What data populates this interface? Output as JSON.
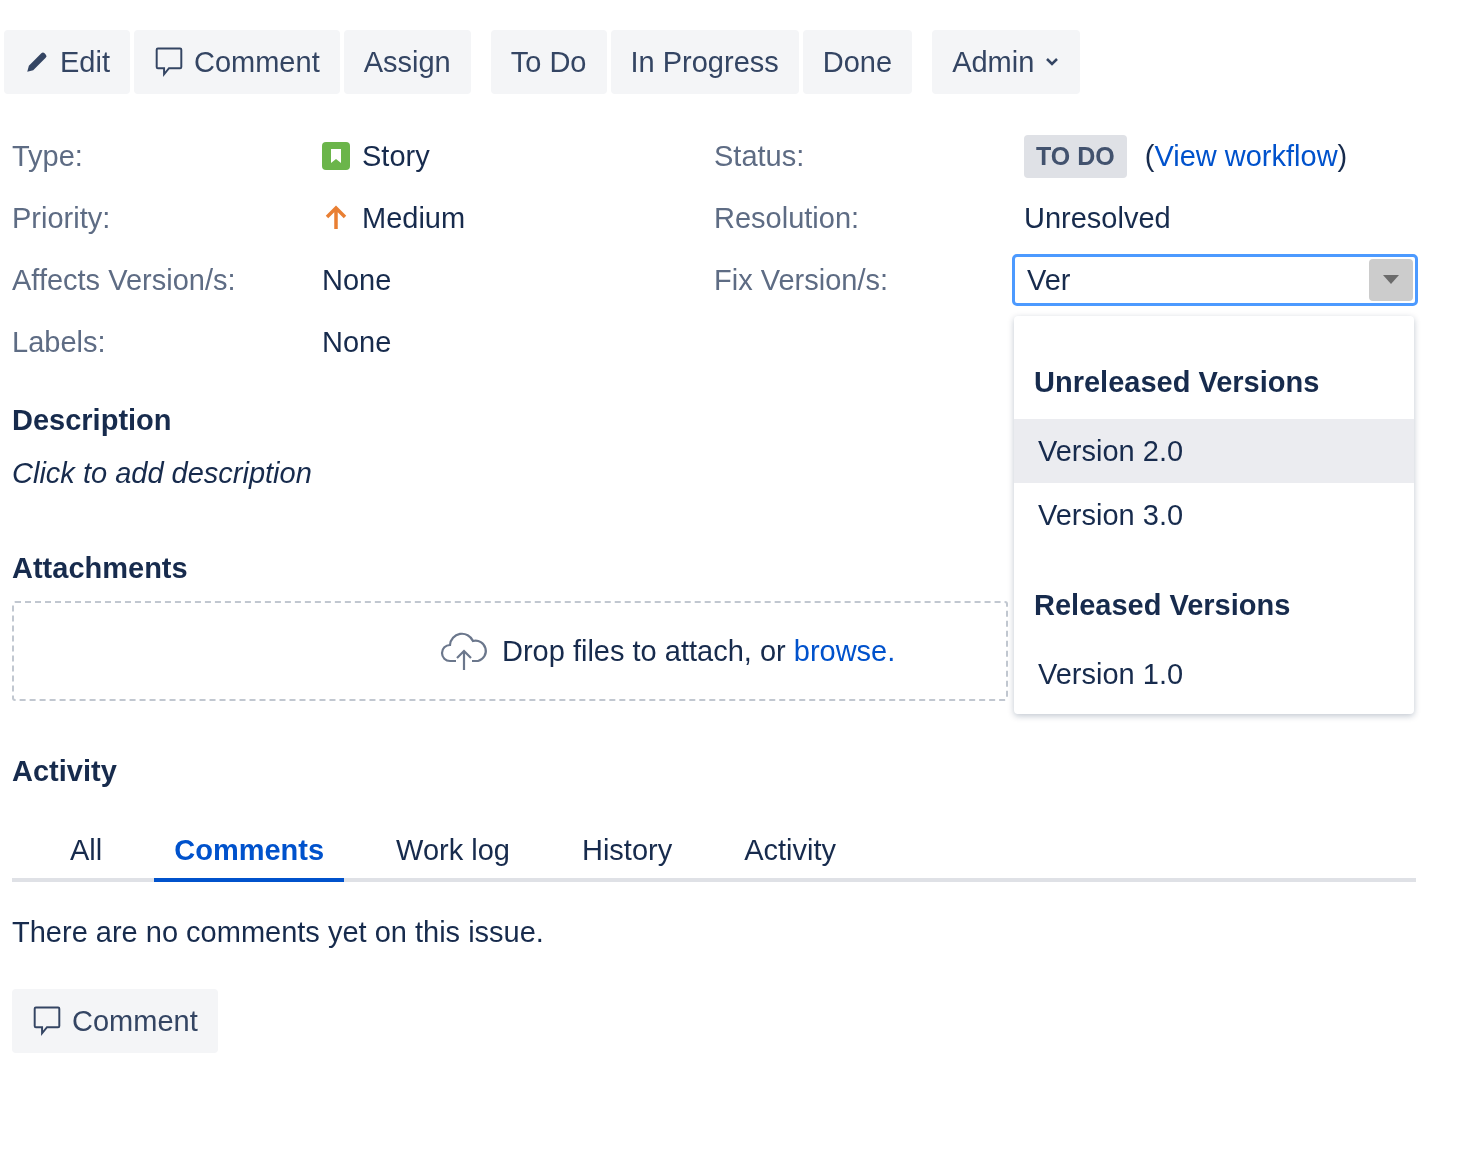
{
  "toolbar": [
    {
      "buttons": [
        {
          "label": "Edit",
          "kind": "edit"
        },
        {
          "label": "Comment",
          "kind": "comment"
        },
        {
          "label": "Assign",
          "kind": "plain"
        }
      ]
    },
    {
      "buttons": [
        {
          "label": "To Do",
          "kind": "plain"
        },
        {
          "label": "In Progress",
          "kind": "plain"
        },
        {
          "label": "Done",
          "kind": "plain"
        }
      ]
    },
    {
      "buttons": [
        {
          "label": "Admin",
          "kind": "menu"
        }
      ]
    }
  ],
  "fields": [
    {
      "label": "Type:",
      "kind": "issue_type",
      "value": "Story"
    },
    {
      "label": "Status:",
      "kind": "lozenge",
      "value": "TO DO",
      "before": "(",
      "link": "View workflow",
      "after": ")"
    },
    {
      "label": "Priority:",
      "kind": "priority",
      "value": "Medium"
    },
    {
      "label": "Resolution:",
      "kind": "text",
      "value": "Unresolved"
    },
    {
      "label": "Affects Version/s:",
      "kind": "text",
      "value": "None"
    },
    {
      "label": "Fix Version/s:",
      "kind": "select",
      "value": "Ver"
    },
    {
      "label": "Labels:",
      "kind": "text",
      "value": "None"
    }
  ],
  "version_menu": [
    {
      "heading": "Unreleased Versions",
      "items": [
        {
          "label": "Version 2.0",
          "selected": true
        },
        {
          "label": "Version 3.0",
          "selected": false
        }
      ]
    },
    {
      "heading": "Released Versions",
      "items": [
        {
          "label": "Version 1.0",
          "selected": false
        }
      ]
    }
  ],
  "description": {
    "heading": "Description",
    "placeholder": "Click to add description"
  },
  "attachments": {
    "heading": "Attachments",
    "text": "Drop files to attach, or",
    "link": "browse."
  },
  "activity": {
    "heading": "Activity",
    "tabs": [
      {
        "label": "All",
        "selected": false
      },
      {
        "label": "Comments",
        "selected": true
      },
      {
        "label": "Work log",
        "selected": false
      },
      {
        "label": "History",
        "selected": false
      },
      {
        "label": "Activity",
        "selected": false
      }
    ],
    "empty_text": "There are no comments yet on this issue.",
    "comment_button": "Comment"
  }
}
